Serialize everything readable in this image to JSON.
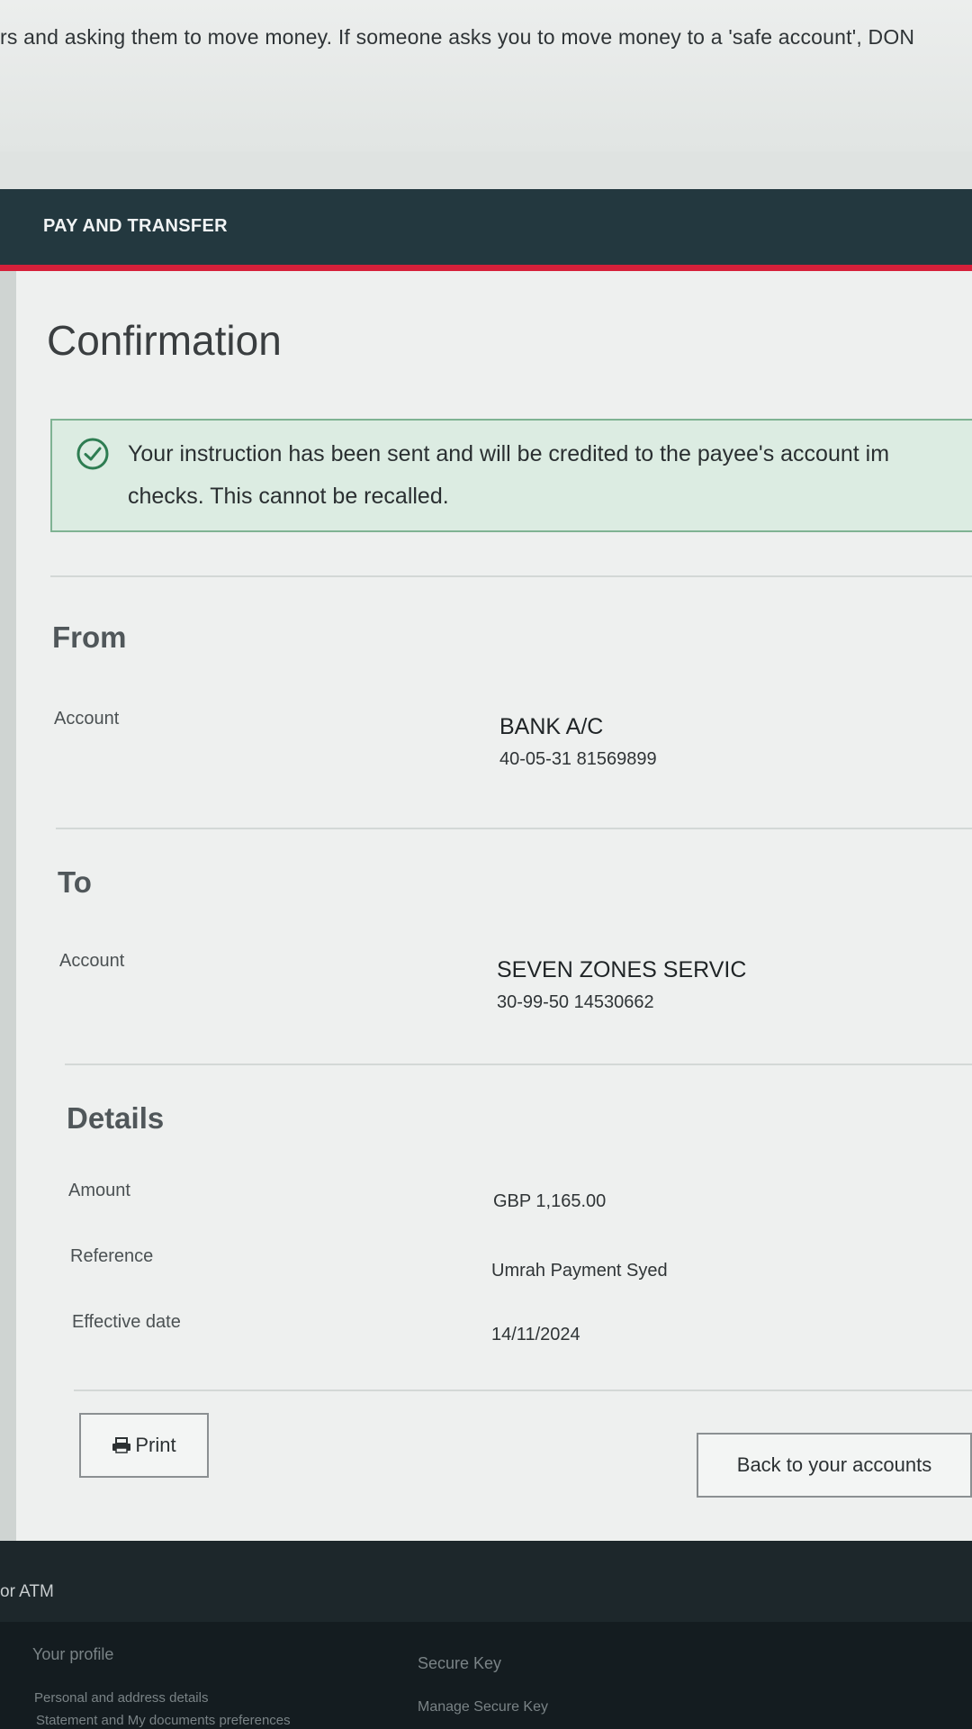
{
  "warning": {
    "text": "rs and asking them to move money. If someone asks you to move money to a 'safe account', DON"
  },
  "nav": {
    "title": "PAY AND TRANSFER"
  },
  "page": {
    "title": "Confirmation"
  },
  "success": {
    "line1": "Your instruction has been sent and will be credited to the payee's account im",
    "line2": "checks. This cannot be recalled."
  },
  "from": {
    "heading": "From",
    "account_label": "Account",
    "account_name": "BANK A/C",
    "account_number": "40-05-31 81569899"
  },
  "to": {
    "heading": "To",
    "account_label": "Account",
    "account_name": "SEVEN ZONES SERVIC",
    "account_number": "30-99-50 14530662"
  },
  "details": {
    "heading": "Details",
    "amount_label": "Amount",
    "amount_value": "GBP 1,165.00",
    "reference_label": "Reference",
    "reference_value": "Umrah Payment Syed",
    "date_label": "Effective date",
    "date_value": "14/11/2024"
  },
  "actions": {
    "print_label": "Print",
    "back_label": "Back to your accounts"
  },
  "footer": {
    "atm_text": "or ATM",
    "col1": {
      "heading": "Your profile",
      "link1": "Personal and address details",
      "link2": "Statement and My documents preferences"
    },
    "col2": {
      "heading": "Secure Key",
      "link1": "Manage Secure Key"
    }
  },
  "colors": {
    "nav_background": "#23383f",
    "accent_red": "#d6203a",
    "success_background": "#dcece2",
    "success_border": "#7fb393",
    "check_icon": "#2e7d52"
  },
  "icons": [
    "check-circle-icon",
    "print-icon"
  ]
}
